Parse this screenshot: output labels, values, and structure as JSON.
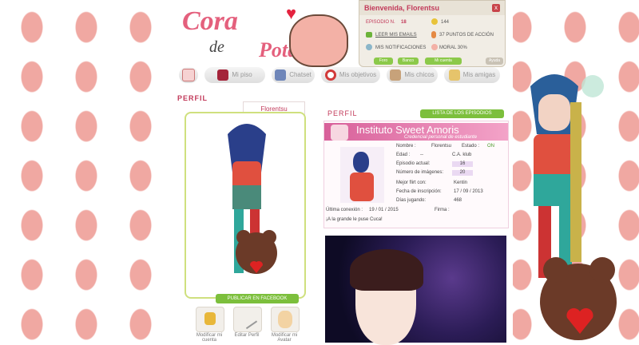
{
  "logo": {
    "line1": "Cora",
    "line2": "de",
    "line3": "Potato"
  },
  "userbox": {
    "greeting": "Bienvenida, Florentsu",
    "close": "x",
    "episode_label": "EPISODIO N.",
    "episode_num": "18",
    "money": "144",
    "messages": "LEER MIS EMAILS",
    "action_points": "37 PUNTOS DE ACCIÓN",
    "notifications": "MIS NOTIFICACIONES",
    "moral": "MORAL 30%",
    "btn_foro": "Foro",
    "btn_banco": "Banco",
    "btn_cuenta": "Mi cuenta",
    "btn_ayuda": "Ayuda"
  },
  "nav": {
    "items": [
      {
        "label": "",
        "icon": "home-icon"
      },
      {
        "label": "Mi piso",
        "icon": "bed-icon"
      },
      {
        "label": "Chatset",
        "icon": "books-icon"
      },
      {
        "label": "Mis objetivos",
        "icon": "target-icon"
      },
      {
        "label": "Mis chicos",
        "icon": "boy-icon"
      },
      {
        "label": "Mis amigas",
        "icon": "girl-icon"
      }
    ]
  },
  "profile": {
    "heading": "PERFIL",
    "heading2": "PERFIL",
    "name": "Florentsu",
    "fb_button": "PUBLICAR EN FACEBOOK",
    "actions": [
      "Modificar mi cuenta",
      "Editar Perfil",
      "Modificar mi Avatar"
    ],
    "episodes_button": "LISTA DE LOS EPISODIOS"
  },
  "card": {
    "title": "Instituto Sweet Amoris",
    "subtitle": "Credencial personal de estudiante",
    "rows": [
      {
        "label": "Nombre :",
        "value": "Florentsu"
      },
      {
        "label": "Edad :",
        "value": "--"
      },
      {
        "label": "Episodio actual:",
        "value": "16"
      },
      {
        "label": "Número de imágenes:",
        "value": "20"
      },
      {
        "label": "Mejor flirt con:",
        "value": "Kentin"
      },
      {
        "label": "Fecha de inscripción:",
        "value": "17 / 09 / 2013"
      },
      {
        "label": "Días jugando:",
        "value": "468"
      }
    ],
    "estado_label": "Estado :",
    "estado_value": "ON",
    "grupo": "C.A. klub",
    "last_conn_label": "Última conexión :",
    "last_conn_value": "19 / 01 / 2015",
    "firma_label": "Firma :",
    "motto": "¡A la grande le puse Cuca!"
  },
  "colors": {
    "accent": "#c23a5a",
    "green": "#7cbf3c",
    "bean": "#f0a8a2"
  }
}
